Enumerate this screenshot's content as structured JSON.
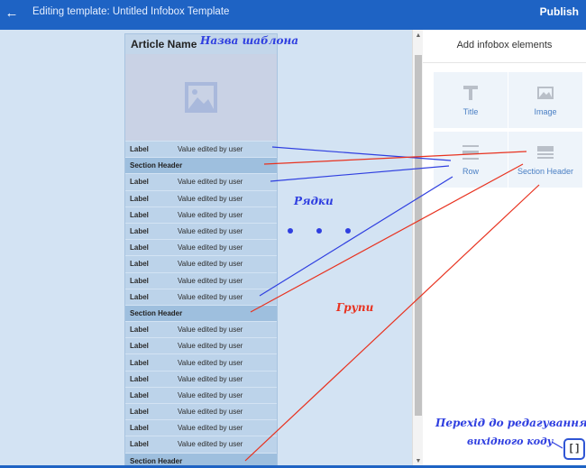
{
  "topbar": {
    "back_icon": "arrow-left-icon",
    "title": "Editing template: Untitled Infobox Template",
    "publish_label": "Publish"
  },
  "infobox": {
    "title": "Article Name",
    "image_icon": "image-placeholder-icon",
    "rows_1": [
      {
        "label": "Label",
        "value": "Value edited by user"
      }
    ],
    "section_1": "Section Header",
    "rows_2": [
      {
        "label": "Label",
        "value": "Value edited by user"
      },
      {
        "label": "Label",
        "value": "Value edited by user"
      },
      {
        "label": "Label",
        "value": "Value edited by user"
      },
      {
        "label": "Label",
        "value": "Value edited by user"
      },
      {
        "label": "Label",
        "value": "Value edited by user"
      },
      {
        "label": "Label",
        "value": "Value edited by user"
      },
      {
        "label": "Label",
        "value": "Value edited by user"
      },
      {
        "label": "Label",
        "value": "Value edited by user"
      }
    ],
    "section_2": "Section Header",
    "rows_3": [
      {
        "label": "Label",
        "value": "Value edited by user"
      },
      {
        "label": "Label",
        "value": "Value edited by user"
      },
      {
        "label": "Label",
        "value": "Value edited by user"
      },
      {
        "label": "Label",
        "value": "Value edited by user"
      },
      {
        "label": "Label",
        "value": "Value edited by user"
      },
      {
        "label": "Label",
        "value": "Value edited by user"
      },
      {
        "label": "Label",
        "value": "Value edited by user"
      },
      {
        "label": "Label",
        "value": "Value edited by user"
      }
    ],
    "section_3": "Section Header"
  },
  "panel": {
    "title": "Add infobox elements",
    "tiles": [
      {
        "label": "Title",
        "icon": "title-t-icon"
      },
      {
        "label": "Image",
        "icon": "image-icon"
      },
      {
        "label": "Row",
        "icon": "row-icon"
      },
      {
        "label": "Section Header",
        "icon": "section-header-icon"
      }
    ],
    "source_button": "[ ]"
  },
  "annotations": {
    "template_name": "Назва шаблона",
    "rows": "Рядки",
    "groups": "Групи",
    "source_line1": "Перехід до редагування",
    "source_line2": "вихідного коду"
  },
  "colors": {
    "accent": "#1e63c4",
    "annotation_blue": "#2f3fe0",
    "annotation_red": "#e8321f"
  }
}
